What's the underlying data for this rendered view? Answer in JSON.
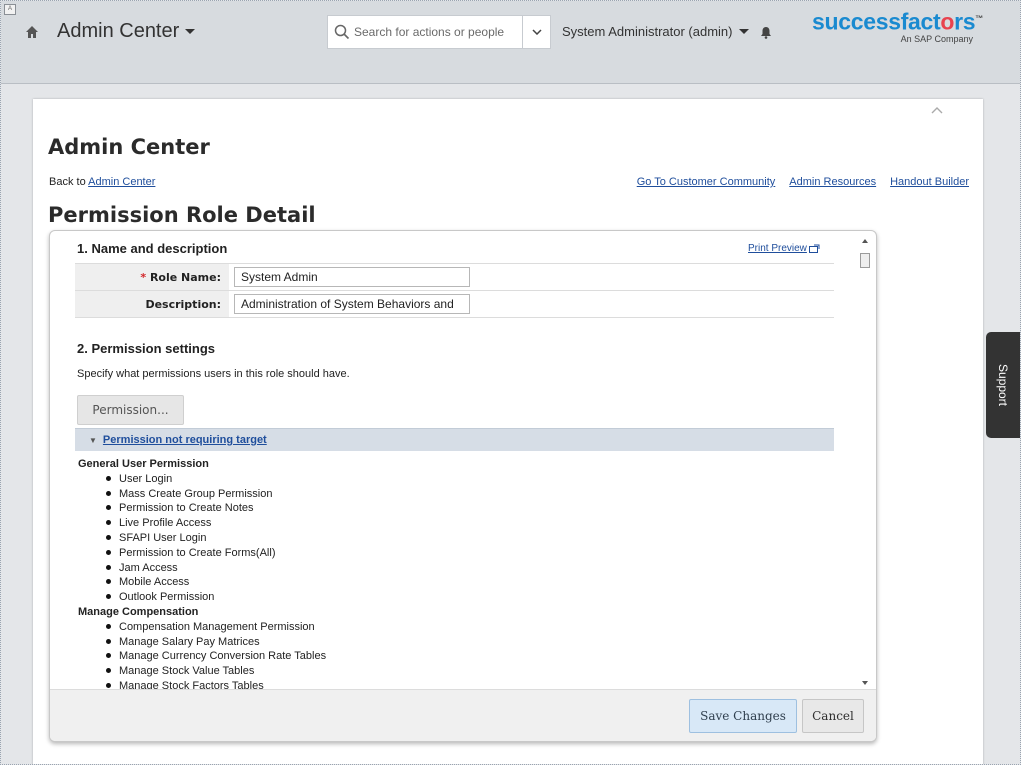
{
  "header": {
    "app_menu": "Admin Center",
    "search_placeholder": "Search for actions or people",
    "user_menu": "System Administrator (admin)",
    "brand": {
      "name_part1": "success",
      "name_part2": "fact",
      "name_part3": "o",
      "name_part4": "rs",
      "tm": "™",
      "sub": "An SAP Company",
      "colors": {
        "blue": "#1a8ad0",
        "red": "#e8434f"
      }
    }
  },
  "page": {
    "admin_title": "Admin Center",
    "back_prefix": "Back to ",
    "back_link": "Admin Center",
    "top_links": [
      "Go To Customer Community",
      "Admin Resources",
      "Handout Builder"
    ],
    "title": "Permission Role Detail"
  },
  "dialog": {
    "section1_title": "1. Name and description",
    "print_preview": "Print Preview",
    "role_name_label": "Role Name:",
    "role_name_required_marker": "*",
    "role_name_value": "System Admin",
    "description_label": "Description:",
    "description_value": "Administration of System Behaviors and",
    "section2_title": "2. Permission settings",
    "section2_desc": "Specify what permissions users in this role should have.",
    "permission_button": "Permission...",
    "group_title": "Permission not requiring target",
    "categories": [
      {
        "title": "General User Permission",
        "items": [
          "User Login",
          "Mass Create Group Permission",
          "Permission to Create Notes",
          "Live Profile Access",
          "SFAPI User Login",
          "Permission to Create Forms(All)",
          "Jam Access",
          "Mobile Access",
          "Outlook Permission"
        ]
      },
      {
        "title": "Manage Compensation",
        "items": [
          "Compensation Management Permission",
          "Manage Salary Pay Matrices",
          "Manage Currency Conversion Rate Tables",
          "Manage Stock Value Tables",
          "Manage Stock Factors Tables"
        ]
      }
    ],
    "save_button": "Save Changes",
    "cancel_button": "Cancel"
  },
  "support_tab": "Support"
}
